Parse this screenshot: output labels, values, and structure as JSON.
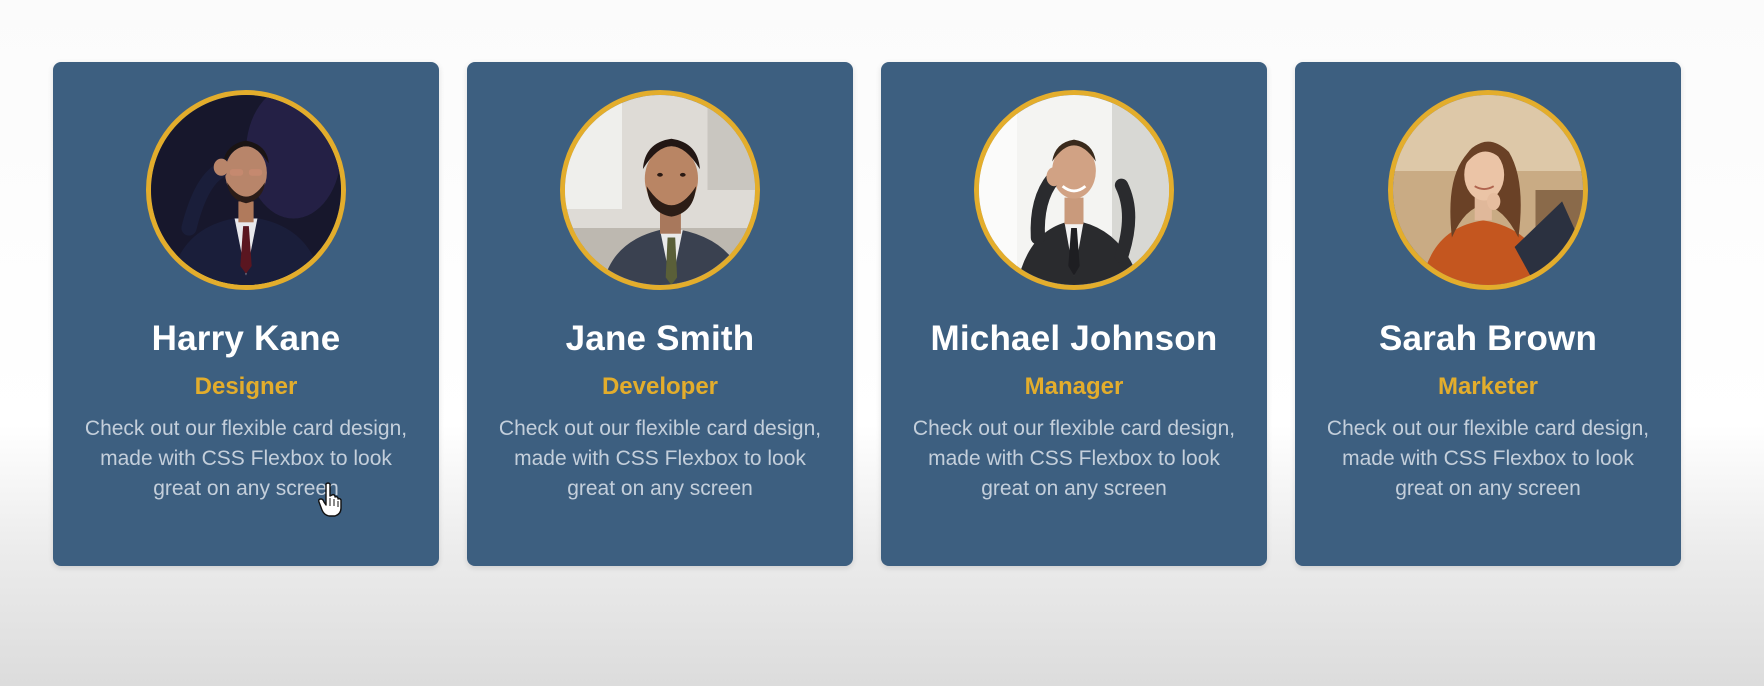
{
  "cards": [
    {
      "name": "Harry Kane",
      "role": "Designer",
      "description": "Check out our flexible card design, made with CSS Flexbox to look great on any screen",
      "photo": "man-sunglasses-dark-suit-photo"
    },
    {
      "name": "Jane Smith",
      "role": "Developer",
      "description": "Check out our flexible card design, made with CSS Flexbox to look great on any screen",
      "photo": "bearded-man-office-photo"
    },
    {
      "name": "Michael Johnson",
      "role": "Manager",
      "description": "Check out our flexible card design, made with CSS Flexbox to look great on any screen",
      "photo": "man-on-phone-photo"
    },
    {
      "name": "Sarah Brown",
      "role": "Marketer",
      "description": "Check out our flexible card design, made with CSS Flexbox to look great on any screen",
      "photo": "woman-with-laptop-photo"
    }
  ],
  "colors": {
    "card_bg": "#3d5f80",
    "accent": "#e3ad2c",
    "name_text": "#ffffff",
    "description_text": "#c4cfdb"
  },
  "cursor": "hand-pointer-icon"
}
